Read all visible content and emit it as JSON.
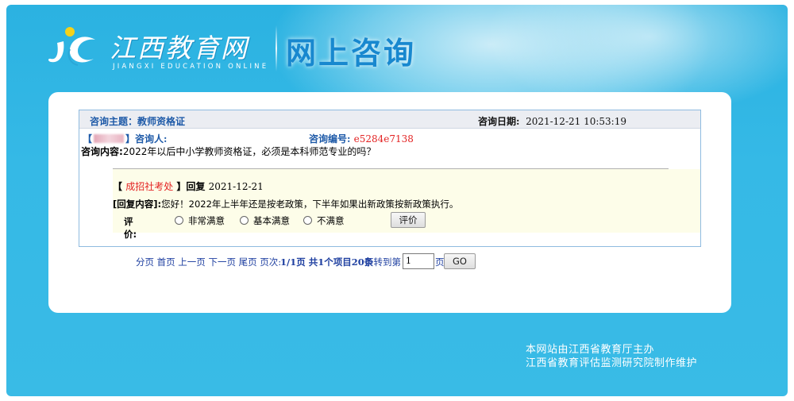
{
  "header": {
    "logo_cn": "江西教育网",
    "logo_en": "JIANGXI EDUCATION ONLINE",
    "page_title": "网上咨询"
  },
  "consult": {
    "topic_label": "咨询主题：",
    "topic": "教师资格证",
    "date_label": "咨询日期:",
    "date": "2021-12-21 10:53:19",
    "asker_open": "【",
    "asker_close": "】咨询人:",
    "id_label": "咨询编号:",
    "id": "e5284e7138",
    "content_label": "咨询内容:",
    "content": "2022年以后中小学教师资格证，必须是本科师范专业的吗？"
  },
  "reply": {
    "open": "【",
    "org": "成招社考处",
    "close": "】回复",
    "date": "2021-12-21",
    "content_label": "[回复内容]:",
    "content": "您好！2022年上半年还是按老政策，下半年如果出新政策按新政策执行。",
    "rating_label": "评价:",
    "options": [
      "非常满意",
      "基本满意",
      "不满意"
    ],
    "rate_button": "评价"
  },
  "pager": {
    "links": "分页 首页 上一页 下一页 尾页 页次:",
    "status": "1/1页 共1个项目20条",
    "goto": "页转到第",
    "page_value": "1",
    "page_suffix": "页",
    "go_button": "GO"
  },
  "footer": {
    "line1": "本网站由江西省教育厅主办",
    "line2": "江西省教育评估监测研究院制作维护"
  },
  "colors": {
    "background": "#35b9e6",
    "title_blue": "#1888cf",
    "link_blue": "#1e5aa8",
    "red": "#e32222",
    "reply_bg": "#fdfde9"
  }
}
